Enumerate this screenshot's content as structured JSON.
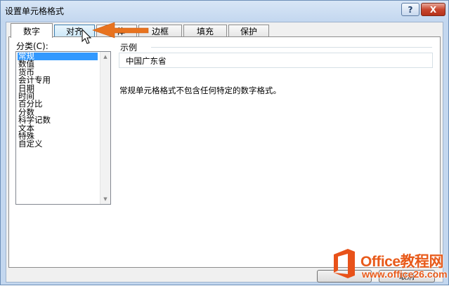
{
  "window": {
    "title": "设置单元格格式",
    "help_label": "?",
    "close_label": "X"
  },
  "tabs": [
    {
      "label": "数字",
      "active": true
    },
    {
      "label": "对齐",
      "hover": true
    },
    {
      "label": "字体"
    },
    {
      "label": "边框"
    },
    {
      "label": "填充"
    },
    {
      "label": "保护"
    }
  ],
  "category": {
    "label": "分类(C):",
    "items": [
      "常规",
      "数值",
      "货币",
      "会计专用",
      "日期",
      "时间",
      "百分比",
      "分数",
      "科学记数",
      "文本",
      "特殊",
      "自定义"
    ],
    "selected": "常规"
  },
  "sample": {
    "legend": "示例",
    "value": "中国广东省"
  },
  "description": "常规单元格格式不包含任何特定的数字格式。",
  "buttons": {
    "cancel_label": "取消"
  },
  "watermark": {
    "title": "Office教程网",
    "url": "www.office26.com"
  },
  "colors": {
    "selection": "#3399ff",
    "arrow": "#e8731f",
    "watermark": "#e85a1a"
  }
}
